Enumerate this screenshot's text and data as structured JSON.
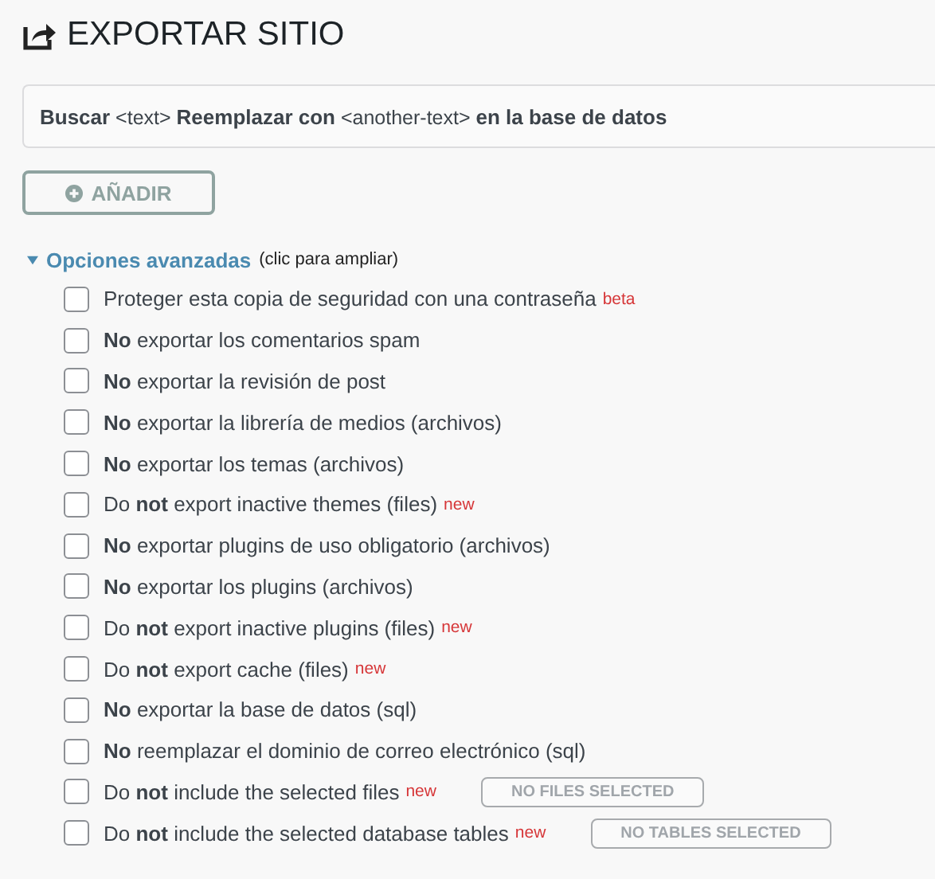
{
  "title": "EXPORTAR SITIO",
  "search_replace": "**Buscar** <text> **Reemplazar con** <another-text> **en la base de datos**",
  "add_button": {
    "label": "AÑADIR",
    "disabled": true
  },
  "advanced": {
    "label": "Opciones avanzadas",
    "hint": "(clic para ampliar)",
    "expanded": true
  },
  "options": [
    {
      "label": "Proteger esta copia de seguridad con una contraseña",
      "checked": false,
      "tag": "beta"
    },
    {
      "label": "**No** exportar los comentarios spam",
      "checked": false
    },
    {
      "label": "**No** exportar la revisión de post",
      "checked": false
    },
    {
      "label": "**No** exportar la librería de medios (archivos)",
      "checked": false
    },
    {
      "label": "**No** exportar los temas (archivos)",
      "checked": false
    },
    {
      "label": "Do **not** export inactive themes (files)",
      "checked": false,
      "tag": "new"
    },
    {
      "label": "**No** exportar plugins de uso obligatorio (archivos)",
      "checked": false
    },
    {
      "label": "**No** exportar los plugins (archivos)",
      "checked": false
    },
    {
      "label": "Do **not** export inactive plugins (files)",
      "checked": false,
      "tag": "new"
    },
    {
      "label": "Do **not** export cache (files)",
      "checked": false,
      "tag": "new"
    },
    {
      "label": "**No** exportar la base de datos (sql)",
      "checked": false
    },
    {
      "label": "**No** reemplazar el dominio de correo electrónico (sql)",
      "checked": false
    },
    {
      "label": "Do **not** include the selected files",
      "checked": false,
      "tag": "new",
      "button": "NO FILES SELECTED"
    },
    {
      "label": "Do **not** include the selected database tables",
      "checked": false,
      "tag": "new",
      "button": "NO TABLES SELECTED"
    }
  ]
}
